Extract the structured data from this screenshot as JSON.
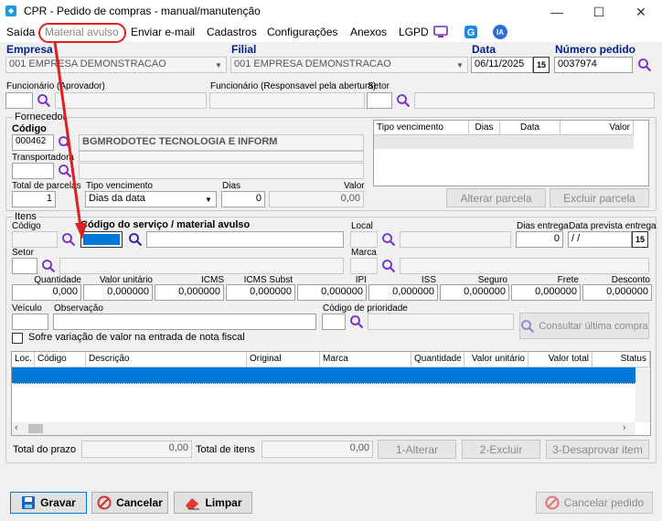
{
  "window": {
    "title": "CPR - Pedido de compras - manual/manutenção"
  },
  "menu": {
    "items": [
      "Saída",
      "Material avulso",
      "Enviar e-mail",
      "Cadastros",
      "Configurações",
      "Anexos",
      "LGPD"
    ],
    "badge_ia": "IA"
  },
  "header": {
    "empresa_label": "Empresa",
    "empresa_value": "001 EMPRESA DEMONSTRACAO",
    "filial_label": "Filial",
    "filial_value": "001 EMPRESA DEMONSTRACAO",
    "data_label": "Data",
    "data_value": "06/11/2025",
    "cal_label": "15",
    "numero_label": "Número pedido",
    "numero_value": "0037974",
    "func_aprov_label": "Funcionário (Aprovador)",
    "func_resp_label": "Funcionário (Responsavel pela abertura)",
    "setor_label": "Setor"
  },
  "fornecedor": {
    "group_label": "Fornecedor",
    "codigo_label": "Código",
    "codigo_value": "000462",
    "nome_value": "BGMRODOTEC TECNOLOGIA E INFORM",
    "transportadora_label": "Transportadora",
    "total_parcelas_label": "Total de parcelas",
    "total_parcelas_value": "1",
    "tipo_venc_label": "Tipo vencimento",
    "tipo_venc_value": "Dias da data",
    "dias_label": "Dias",
    "dias_value": "0",
    "valor_label": "Valor",
    "valor_value": "0,00",
    "grid_headers": [
      "Tipo vencimento",
      "Dias",
      "Data",
      "Valor"
    ],
    "alterar_parcela": "Alterar parcela",
    "excluir_parcela": "Excluir parcela"
  },
  "itens": {
    "group_label": "Itens",
    "codigo_label": "Código",
    "codigo_servico_label": "Código do serviço / material avulso",
    "local_label": "Local",
    "dias_entrega_label": "Dias entrega",
    "dias_entrega_value": "0",
    "data_prevista_label": "Data prevista entrega",
    "data_prevista_value": "/ /",
    "setor_label": "Setor",
    "marca_label": "Marca",
    "valores": [
      {
        "label": "Quantidade",
        "value": "0,000"
      },
      {
        "label": "Valor unitário",
        "value": "0,000000"
      },
      {
        "label": "ICMS",
        "value": "0,000000"
      },
      {
        "label": "ICMS Subst",
        "value": "0,000000"
      },
      {
        "label": "IPI",
        "value": "0,000000"
      },
      {
        "label": "ISS",
        "value": "0,000000"
      },
      {
        "label": "Seguro",
        "value": "0,000000"
      },
      {
        "label": "Frete",
        "value": "0,000000"
      },
      {
        "label": "Desconto",
        "value": "0,000000"
      }
    ],
    "veiculo_label": "Veículo",
    "observacao_label": "Observação",
    "prioridade_label": "Código de prioridade",
    "consultar_label": "Consultar última compra",
    "sofre_variacao_label": "Sofre variação de valor na entrada de nota fiscal",
    "grid_headers": [
      "Loc.",
      "Código",
      "Descrição",
      "Original",
      "Marca",
      "Quantidade",
      "Valor unitário",
      "Valor total",
      "Status"
    ],
    "total_prazo_label": "Total do prazo",
    "total_prazo_value": "0,00",
    "total_itens_label": "Total de itens",
    "total_itens_value": "0,00",
    "btn_alterar": "1-Alterar",
    "btn_excluir": "2-Excluir",
    "btn_desaprovar": "3-Desaprovar item"
  },
  "footer": {
    "gravar": "Gravar",
    "cancelar": "Cancelar",
    "limpar": "Limpar",
    "cancelar_pedido": "Cancelar pedido"
  },
  "colors": {
    "accent_blue": "#0078d7",
    "label_blue": "#001f8c",
    "arrow_red": "#e02020",
    "icon_purple": "#7a2bc8"
  }
}
